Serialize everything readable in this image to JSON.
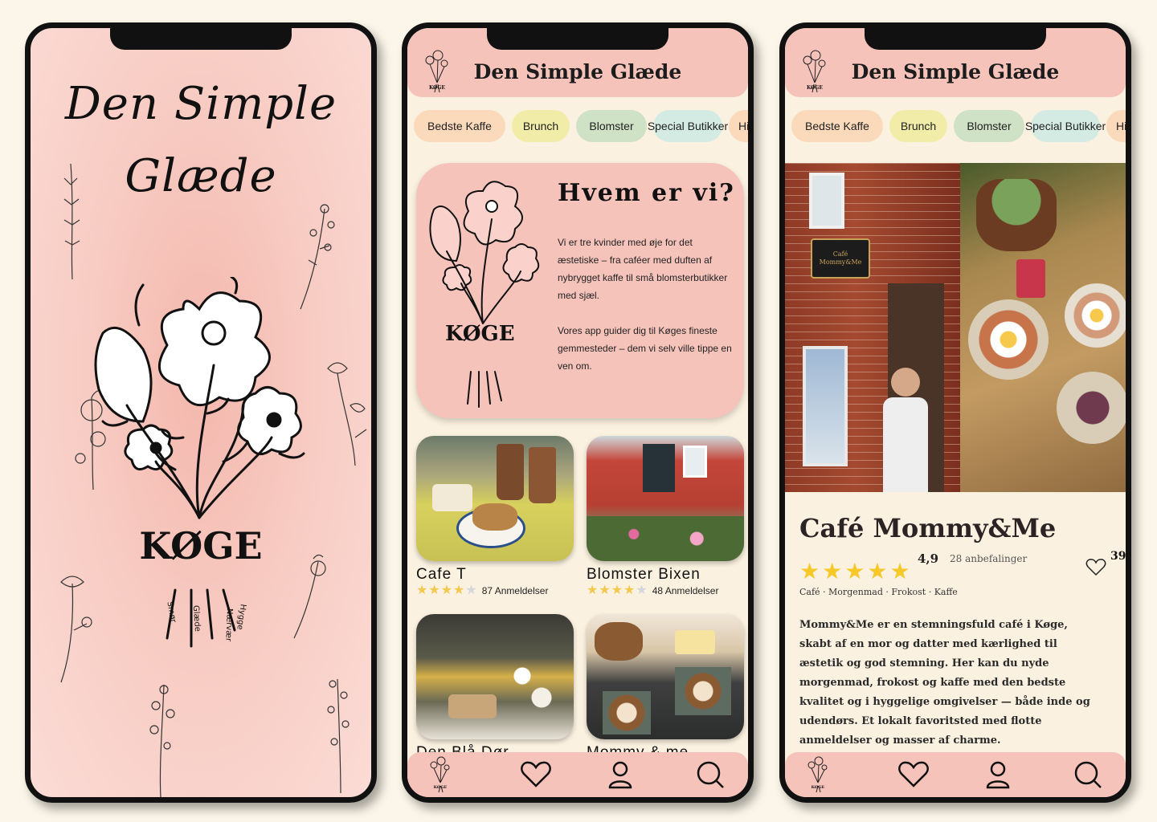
{
  "splash": {
    "title_line1": "Den Simple",
    "title_line2": "Glæde",
    "koge_label": "KØGE",
    "ribbon_words": [
      "Smør",
      "Glæde",
      "Nærvær",
      "Hygge"
    ]
  },
  "app": {
    "title": "Den Simple Glæde",
    "logo_label": "KØGE",
    "categories": [
      "Bedste Kaffe",
      "Brunch",
      "Blomster",
      "Special Butikker",
      "Hi Ge"
    ]
  },
  "about": {
    "title": "Hvem er vi?",
    "koge_label": "KØGE",
    "paragraph1": "Vi er tre kvinder med øje for det æstetiske – fra caféer med duften af nybrygget kaffe til små blomsterbutikker med sjæl.",
    "paragraph2": "Vores app guider dig til Køges fineste gemmesteder – dem vi selv ville tippe en ven om."
  },
  "places": [
    {
      "name": "Cafe T",
      "rating": 4,
      "reviews": "87 Anmeldelser"
    },
    {
      "name": "Blomster Bixen",
      "rating": 4,
      "reviews": "48 Anmeldelser"
    },
    {
      "name": "Den Blå Dør"
    },
    {
      "name": "Mommy & me"
    }
  ],
  "detail": {
    "sign_line1": "Café",
    "sign_line2": "Mommy&Me",
    "name": "Café Mommy&Me",
    "rating": "4,9",
    "recommendations": "28 anbefalinger",
    "favorites": "39",
    "categories": "Café · Morgenmad · Frokost · Kaffe",
    "description": "Mommy&Me er en stemningsfuld café i Køge, skabt af en mor og datter med kærlighed til æstetik og god stemning. Her kan du nyde morgenmad, frokost og kaffe med den bedste kvalitet og i hyggelige omgivelser — både inde og udendørs. Et lokalt favoritsted med flotte anmeldelser og masser af charme."
  },
  "nav": {
    "items": [
      "home-logo",
      "heart-icon",
      "user-icon",
      "search-icon"
    ]
  },
  "colors": {
    "pink": "#f6c3bb",
    "cream": "#fbf1e0",
    "star": "#f3c84f"
  }
}
